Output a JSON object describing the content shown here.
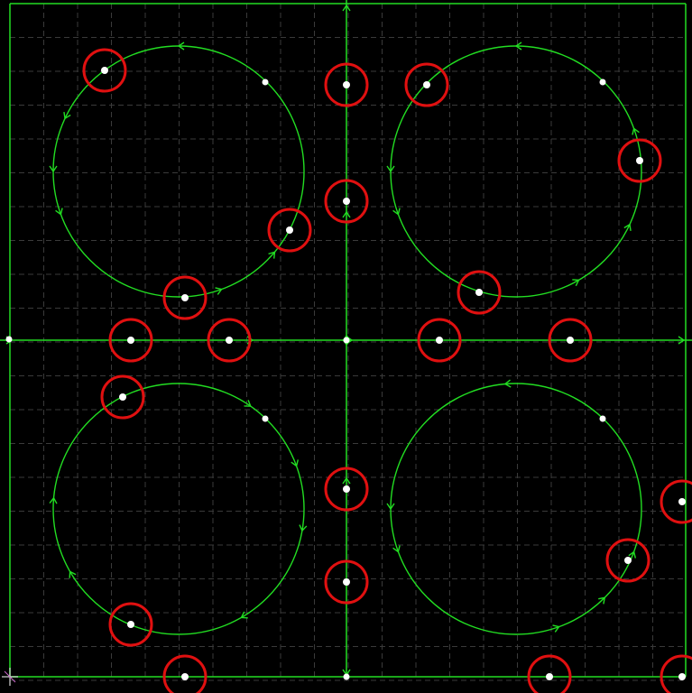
{
  "canvas": {
    "background_color": "#000000",
    "grid_color": "#3a3a3a",
    "grid_style": "dashed",
    "geometry_color": "#22dd22",
    "node_color": "#ffffff",
    "marker_color": "#e01010",
    "direction_arrow_icon": "arrowhead-icon",
    "origin_icon": "origin-axes-icon"
  },
  "circles": [
    {
      "id": "circle-top-left",
      "direction": "counterclockwise",
      "start_node": "top-left",
      "flagged_nodes": 3,
      "plain_nodes": 1
    },
    {
      "id": "circle-top-right",
      "direction": "counterclockwise",
      "start_node": "top-left",
      "flagged_nodes": 3,
      "plain_nodes": 1
    },
    {
      "id": "circle-bottom-left",
      "direction": "clockwise",
      "start_node": "top-left",
      "flagged_nodes": 2,
      "plain_nodes": 1
    },
    {
      "id": "circle-bottom-right",
      "direction": "counterclockwise",
      "start_node": "top-right",
      "flagged_nodes": 1,
      "plain_nodes": 1
    }
  ],
  "summary": {
    "flagged_node_count": 21,
    "plain_node_count": 7
  }
}
